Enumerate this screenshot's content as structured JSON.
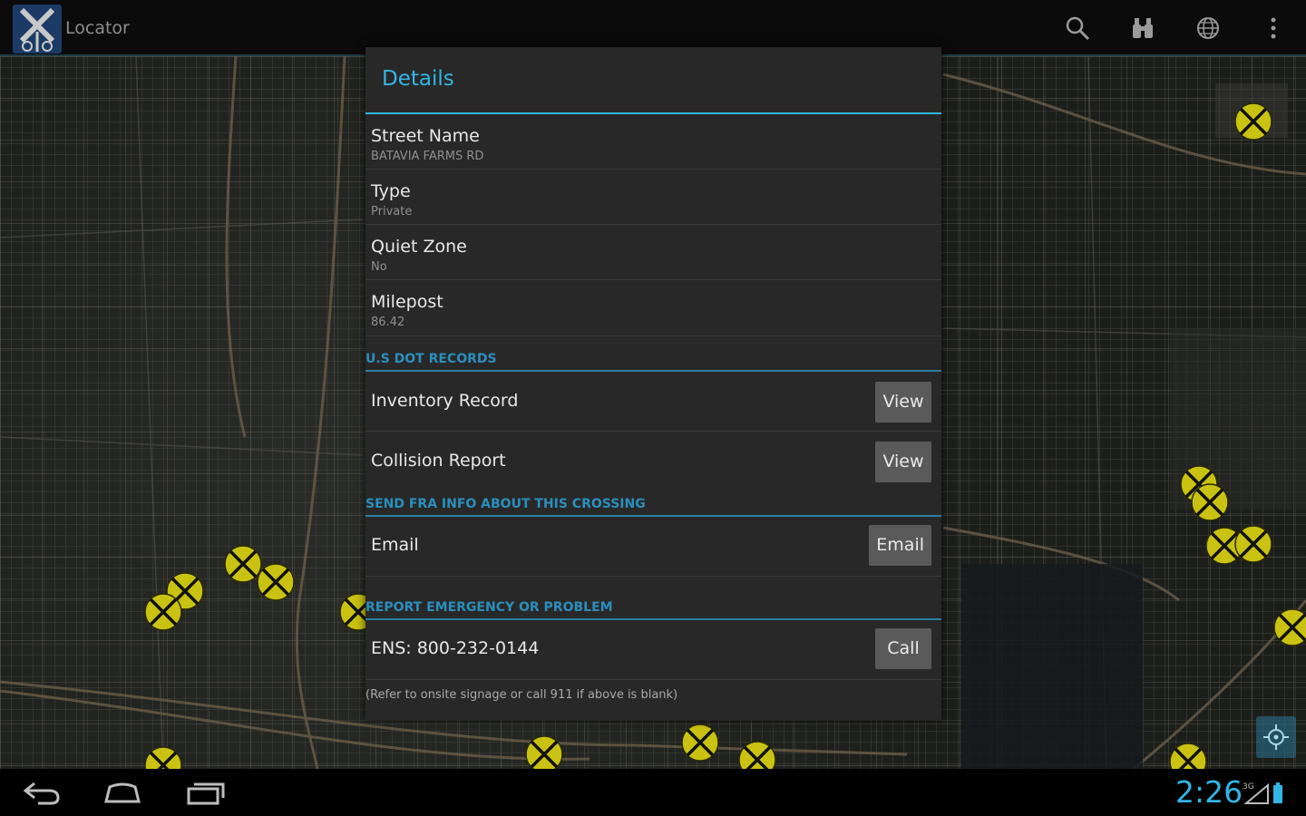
{
  "app": {
    "title": "Locator",
    "icons": [
      "search-icon",
      "binoculars-icon",
      "globe-icon",
      "overflow-menu-icon"
    ]
  },
  "dialog": {
    "title": "Details",
    "fields": [
      {
        "label": "Street Name",
        "value": "BATAVIA FARMS RD"
      },
      {
        "label": "Type",
        "value": "Private"
      },
      {
        "label": "Quiet Zone",
        "value": "No"
      },
      {
        "label": "Milepost",
        "value": "86.42"
      }
    ],
    "sections": {
      "dot_records": {
        "header": "U.S DOT RECORDS",
        "rows": [
          {
            "label": "Inventory Record",
            "button": "View"
          },
          {
            "label": "Collision Report",
            "button": "View"
          }
        ]
      },
      "send_info": {
        "header": "SEND FRA INFO ABOUT THIS CROSSING",
        "rows": [
          {
            "label": "Email",
            "button": "Email"
          }
        ]
      },
      "report": {
        "header": "REPORT EMERGENCY OR PROBLEM",
        "rows": [
          {
            "label": "ENS: 800-232-0144",
            "button": "Call"
          }
        ],
        "note": "(Refer to onsite signage or call 911 if above is blank)"
      }
    }
  },
  "status": {
    "time": "2:26",
    "signal": "3G"
  },
  "colors": {
    "accent": "#33b5e5",
    "marker": "#c9c212",
    "dialog_bg": "#282828",
    "button_bg": "#5a5a5a"
  }
}
